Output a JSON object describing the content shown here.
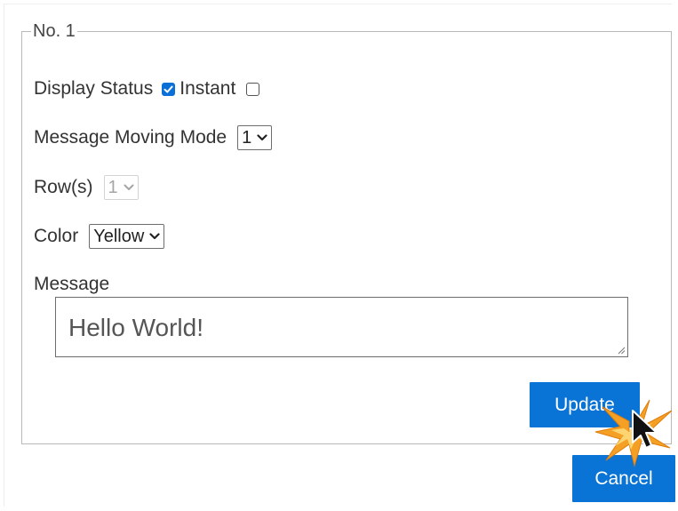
{
  "form": {
    "legend": "No. 1",
    "display_status_label": "Display Status",
    "display_status_checked": true,
    "instant_label": "Instant",
    "instant_checked": false,
    "moving_mode_label": "Message Moving Mode",
    "moving_mode_value": "1",
    "rows_label": "Row(s)",
    "rows_value": "1",
    "color_label": "Color",
    "color_value": "Yellow",
    "message_label": "Message",
    "message_value": "Hello World!"
  },
  "buttons": {
    "update_label": "Update",
    "cancel_label": "Cancel"
  },
  "colors": {
    "accent": "#0a74d6",
    "checkbox_checked": "#0b6fd8",
    "click_highlight": "#f4a024"
  },
  "icons": {
    "select_chevron": "chevron-down-icon",
    "checkbox_check": "check-icon",
    "cursor": "mouse-pointer-icon",
    "click_effect": "click-burst-icon"
  }
}
